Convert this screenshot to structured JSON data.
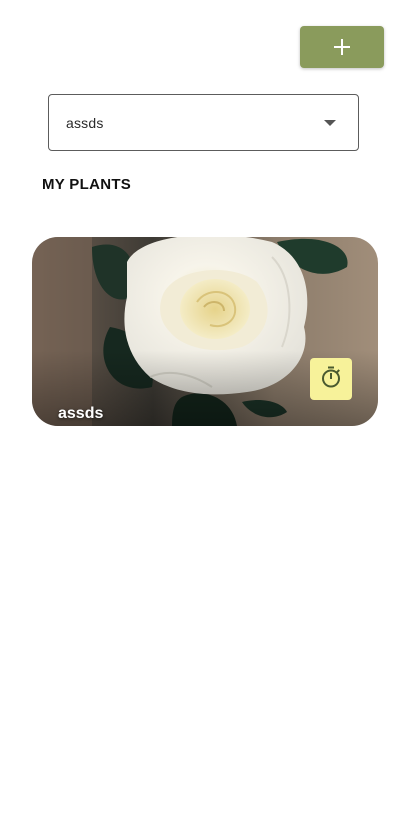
{
  "header": {
    "add_button_icon": "plus-icon",
    "add_button_color": "#8a9b5c"
  },
  "plant_selector": {
    "selected_value": "assds",
    "icon": "chevron-down-icon"
  },
  "section": {
    "title": "MY PLANTS"
  },
  "plants": [
    {
      "name": "assds",
      "image": "white-rose-photo",
      "timer_icon": "stopwatch-icon",
      "timer_color": "#f7f29a"
    }
  ]
}
